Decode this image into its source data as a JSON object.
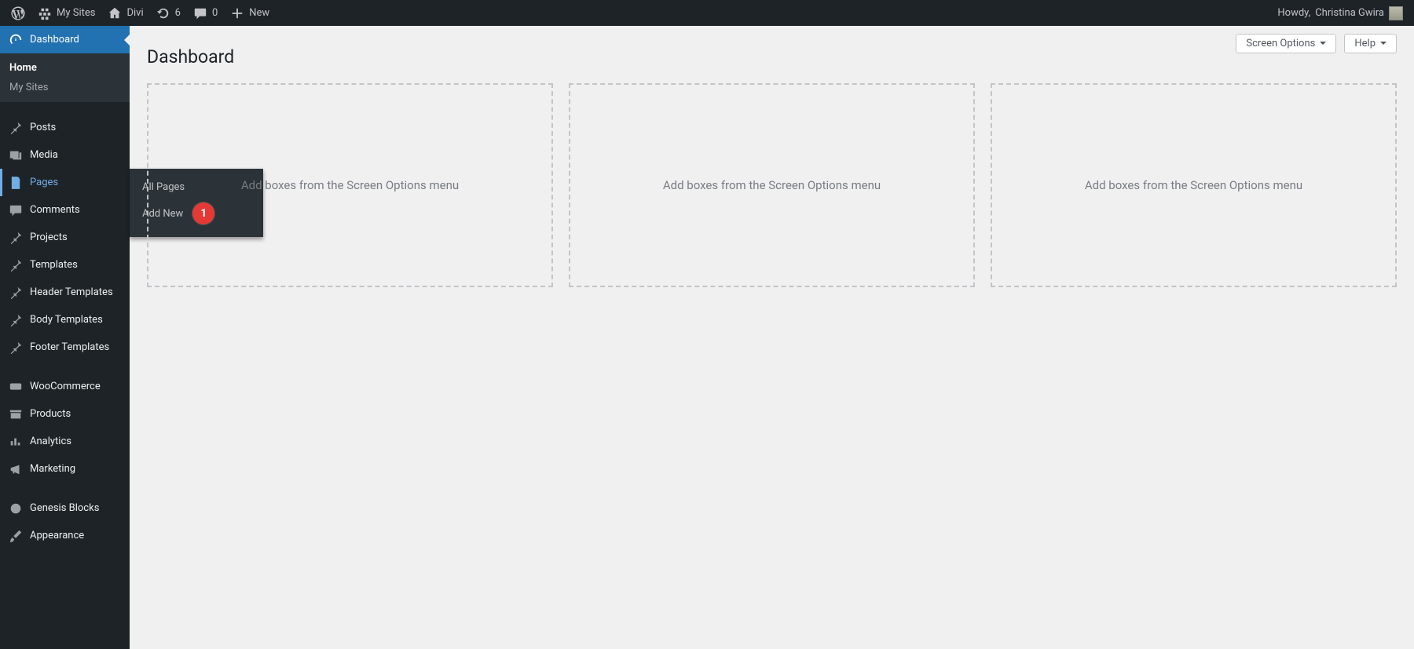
{
  "adminbar": {
    "my_sites": "My Sites",
    "site_name": "Divi",
    "updates_count": "6",
    "comments_count": "0",
    "new_label": "New",
    "howdy_prefix": "Howdy, ",
    "user_name": "Christina Gwira"
  },
  "sidebar": {
    "dashboard": "Dashboard",
    "dashboard_sub": {
      "home": "Home",
      "my_sites": "My Sites"
    },
    "posts": "Posts",
    "media": "Media",
    "pages": "Pages",
    "pages_sub": {
      "all_pages": "All Pages",
      "add_new": "Add New"
    },
    "comments": "Comments",
    "projects": "Projects",
    "templates": "Templates",
    "header_templates": "Header Templates",
    "body_templates": "Body Templates",
    "footer_templates": "Footer Templates",
    "woocommerce": "WooCommerce",
    "products": "Products",
    "analytics": "Analytics",
    "marketing": "Marketing",
    "genesis_blocks": "Genesis Blocks",
    "appearance": "Appearance"
  },
  "content": {
    "page_title": "Dashboard",
    "screen_options": "Screen Options",
    "help": "Help",
    "empty_box": "Add boxes from the Screen Options menu"
  },
  "annotation": {
    "marker_1": "1"
  }
}
